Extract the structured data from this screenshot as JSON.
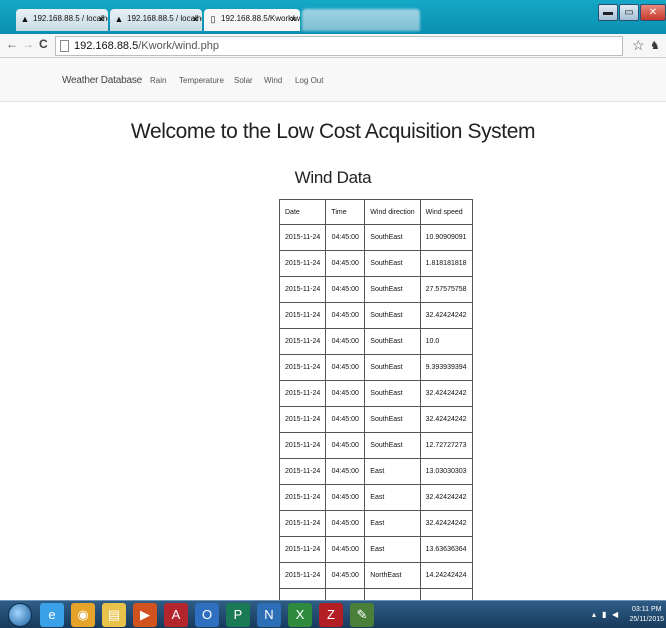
{
  "browser": {
    "tabs": [
      {
        "title": "192.168.88.5 / localhost /",
        "close": "×"
      },
      {
        "title": "192.168.88.5 / localhost /",
        "close": "×"
      },
      {
        "title": "192.168.88.5/Kwork/wind",
        "close": "×"
      }
    ],
    "window_controls": {
      "minimize": "▬",
      "maximize": "▭",
      "close": "✕"
    },
    "nav": {
      "back": "←",
      "forward": "→",
      "reload": "C"
    },
    "url_host": "192.168.88.5",
    "url_path": "/Kwork/wind.php",
    "star": "☆"
  },
  "navbar": {
    "brand": "Weather Database",
    "links": [
      "Rain",
      "Temperature",
      "Solar",
      "Wind",
      "Log Out"
    ]
  },
  "page": {
    "welcome": "Welcome to the Low Cost Acquisition System",
    "subtitle": "Wind Data"
  },
  "table": {
    "headers": [
      "Date",
      "Time",
      "Wind direction",
      "Wind speed"
    ],
    "rows": [
      [
        "2015-11-24",
        "04:45:00",
        "SouthEast",
        "10.90909091"
      ],
      [
        "2015-11-24",
        "04:45:00",
        "SouthEast",
        "1.818181818"
      ],
      [
        "2015-11-24",
        "04:45:00",
        "SouthEast",
        "27.57575758"
      ],
      [
        "2015-11-24",
        "04:45:00",
        "SouthEast",
        "32.42424242"
      ],
      [
        "2015-11-24",
        "04:45:00",
        "SouthEast",
        "10.0"
      ],
      [
        "2015-11-24",
        "04:45:00",
        "SouthEast",
        "9.393939394"
      ],
      [
        "2015-11-24",
        "04:45:00",
        "SouthEast",
        "32.42424242"
      ],
      [
        "2015-11-24",
        "04:45:00",
        "SouthEast",
        "32.42424242"
      ],
      [
        "2015-11-24",
        "04:45:00",
        "SouthEast",
        "12.72727273"
      ],
      [
        "2015-11-24",
        "04:45:00",
        "East",
        "13.03030303"
      ],
      [
        "2015-11-24",
        "04:45:00",
        "East",
        "32.42424242"
      ],
      [
        "2015-11-24",
        "04:45:00",
        "East",
        "32.42424242"
      ],
      [
        "2015-11-24",
        "04:45:00",
        "East",
        "13.63636364"
      ],
      [
        "2015-11-24",
        "04:45:00",
        "NorthEast",
        "14.24242424"
      ],
      [
        "",
        "",
        "",
        ""
      ]
    ]
  },
  "taskbar": {
    "time": "03:11 PM",
    "date": "25/11/2015",
    "apps": [
      {
        "name": "ie-icon",
        "glyph": "e",
        "color": "#3aa0e8"
      },
      {
        "name": "chrome-icon",
        "glyph": "◉",
        "color": "#e5a32a"
      },
      {
        "name": "folder-icon",
        "glyph": "▤",
        "color": "#e8c24a"
      },
      {
        "name": "media-player-icon",
        "glyph": "▶",
        "color": "#d0531f"
      },
      {
        "name": "access-icon",
        "glyph": "A",
        "color": "#b4262d"
      },
      {
        "name": "outlook-icon",
        "glyph": "O",
        "color": "#2f6fbf"
      },
      {
        "name": "publisher-icon",
        "glyph": "P",
        "color": "#1b7a56"
      },
      {
        "name": "onenote-icon",
        "glyph": "N",
        "color": "#2c6fb7"
      },
      {
        "name": "excel-icon",
        "glyph": "X",
        "color": "#2e8b3e"
      },
      {
        "name": "filezilla-icon",
        "glyph": "Z",
        "color": "#b21e24"
      },
      {
        "name": "tool-icon",
        "glyph": "✎",
        "color": "#4a7f3a"
      }
    ]
  }
}
